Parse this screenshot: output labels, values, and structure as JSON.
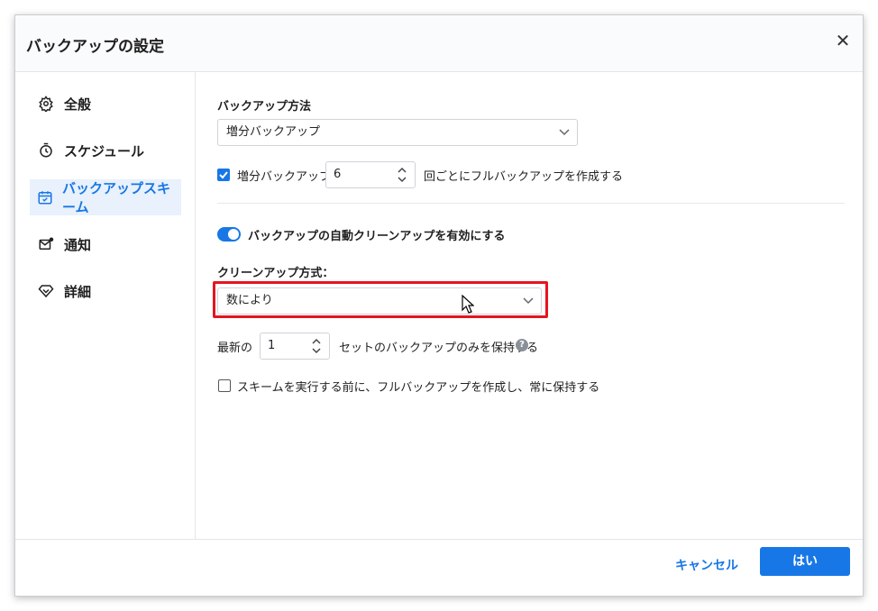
{
  "window": {
    "title": "バックアップの設定",
    "close_glyph": "✕"
  },
  "sidebar": {
    "items": [
      {
        "label": "全般",
        "icon": "gear-icon",
        "active": false
      },
      {
        "label": "スケジュール",
        "icon": "timer-icon",
        "active": false
      },
      {
        "label": "バックアップスキーム",
        "icon": "calendar-check-icon",
        "active": true
      },
      {
        "label": "通知",
        "icon": "mail-notification-icon",
        "active": false
      },
      {
        "label": "詳細",
        "icon": "diamond-icon",
        "active": false
      }
    ]
  },
  "backup_method": {
    "label": "バックアップ方法",
    "selected": "増分バックアップ"
  },
  "incremental": {
    "checked": true,
    "label": "増分バックアップ",
    "count": "6",
    "suffix": "回ごとにフルバックアップを作成する"
  },
  "auto_cleanup": {
    "enabled": true,
    "label": "バックアップの自動クリーンアップを有効にする"
  },
  "cleanup_method": {
    "label": "クリーンアップ方式：",
    "selected": "数により"
  },
  "keep_latest": {
    "prefix": "最新の",
    "count": "1",
    "suffix": "セットのバックアップのみを保持する",
    "help_glyph": "?"
  },
  "full_before_scheme": {
    "checked": false,
    "label": "スキームを実行する前に、フルバックアップを作成し、常に保持する"
  },
  "footer": {
    "cancel_label": "キャンセル",
    "ok_label": "はい"
  },
  "colors": {
    "accent": "#1877e6",
    "highlight": "#e5141f"
  }
}
